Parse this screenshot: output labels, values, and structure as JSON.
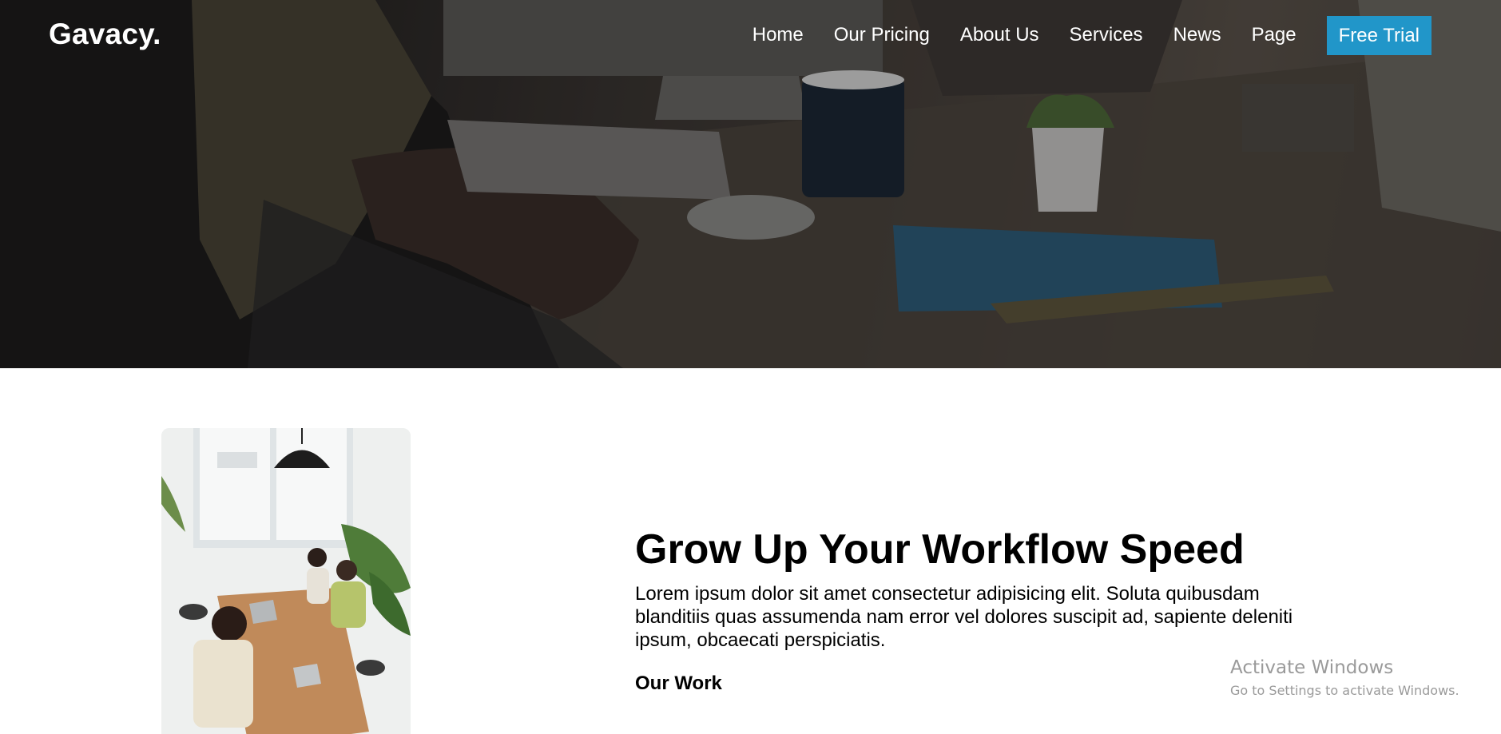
{
  "brand": {
    "logo_text": "Gavacy."
  },
  "nav": {
    "items": [
      {
        "label": "Home"
      },
      {
        "label": "Our Pricing"
      },
      {
        "label": "About Us"
      },
      {
        "label": "Services"
      },
      {
        "label": "News"
      },
      {
        "label": "Page"
      }
    ],
    "cta_label": "Free Trial"
  },
  "feature": {
    "title": "Grow Up Your Workflow Speed",
    "description": "Lorem ipsum dolor sit amet consectetur adipisicing elit. Soluta quibusdam blanditiis quas assumenda nam error vel dolores suscipit ad, sapiente deleniti ipsum, obcaecati perspiciatis.",
    "subheading": "Our Work"
  },
  "system_watermark": {
    "line1": "Activate Windows",
    "line2": "Go to Settings to activate Windows."
  },
  "colors": {
    "accent": "#2196c9",
    "hero_overlay": "#2b2725",
    "text": "#000000",
    "watermark": "#9a9a9a"
  },
  "icons": {
    "hero_image": "office-desk-photo",
    "team_image": "team-meeting-photo"
  }
}
